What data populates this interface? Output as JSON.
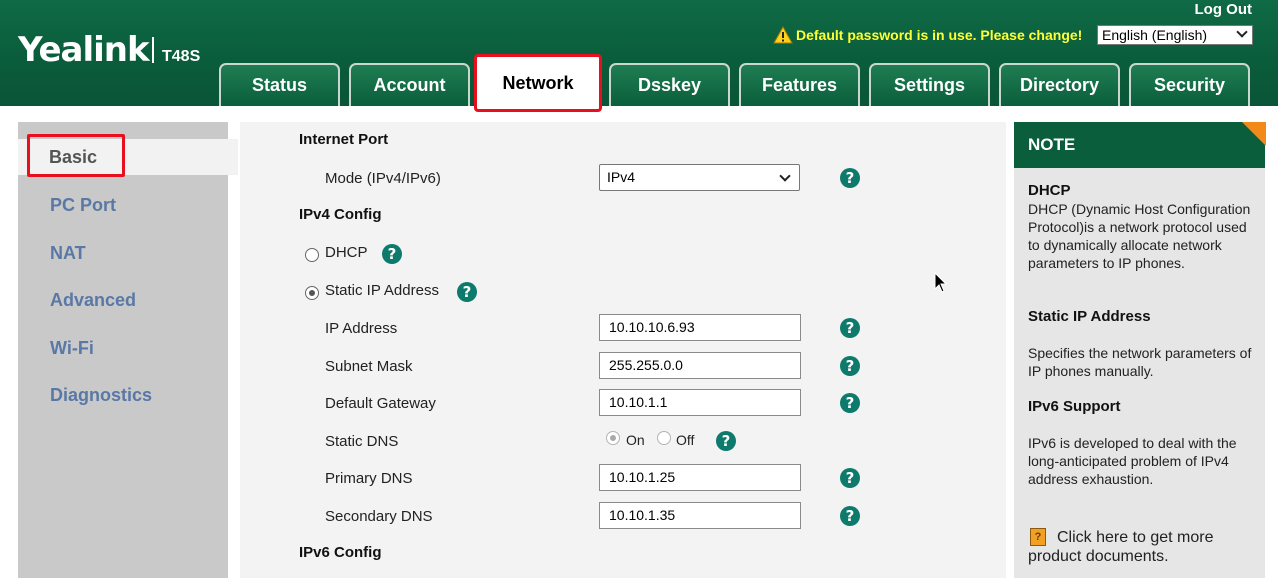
{
  "header": {
    "brand": "Yealink",
    "model": "T48S",
    "logout": "Log Out",
    "warning": "Default password is in use. Please change!",
    "language": "English (English)"
  },
  "tabs": [
    {
      "label": "Status"
    },
    {
      "label": "Account"
    },
    {
      "label": "Network",
      "active": true
    },
    {
      "label": "Dsskey"
    },
    {
      "label": "Features"
    },
    {
      "label": "Settings"
    },
    {
      "label": "Directory"
    },
    {
      "label": "Security"
    }
  ],
  "sidebar": {
    "items": [
      {
        "label": "Basic",
        "active": true
      },
      {
        "label": "PC Port"
      },
      {
        "label": "NAT"
      },
      {
        "label": "Advanced"
      },
      {
        "label": "Wi-Fi"
      },
      {
        "label": "Diagnostics"
      }
    ]
  },
  "form": {
    "internet_port": "Internet Port",
    "mode_label": "Mode (IPv4/IPv6)",
    "mode_value": "IPv4",
    "ipv4_config": "IPv4 Config",
    "dhcp_label": "DHCP",
    "static_label": "Static IP Address",
    "ip_label": "IP Address",
    "ip_value": "10.10.10.6.93",
    "subnet_label": "Subnet Mask",
    "subnet_value": "255.255.0.0",
    "gateway_label": "Default Gateway",
    "gateway_value": "10.10.1.1",
    "static_dns_label": "Static DNS",
    "on_label": "On",
    "off_label": "Off",
    "primary_dns_label": "Primary DNS",
    "primary_dns_value": "10.10.1.25",
    "secondary_dns_label": "Secondary DNS",
    "secondary_dns_value": "10.10.1.35",
    "ipv6_config": "IPv6 Config",
    "help_glyph": "?"
  },
  "note": {
    "heading": "NOTE",
    "dhcp_title": "DHCP",
    "dhcp_text": "DHCP (Dynamic Host Configuration Protocol)is a network protocol used to dynamically allocate network parameters to IP phones.",
    "static_title": "Static IP Address",
    "static_text": "Specifies the network parameters of IP phones manually.",
    "ipv6_title": "IPv6 Support",
    "ipv6_text": "IPv6 is developed to deal with the long-anticipated problem of IPv4 address exhaustion.",
    "doc_link": "Click here to get more product documents.",
    "doc_icon_glyph": "?"
  },
  "colors": {
    "brand_green": "#0b5e3c",
    "highlight_red": "#e8101f",
    "warning_yellow": "#ffff33",
    "sidebar_link": "#5a78a6",
    "help_teal": "#0d7a6b"
  }
}
